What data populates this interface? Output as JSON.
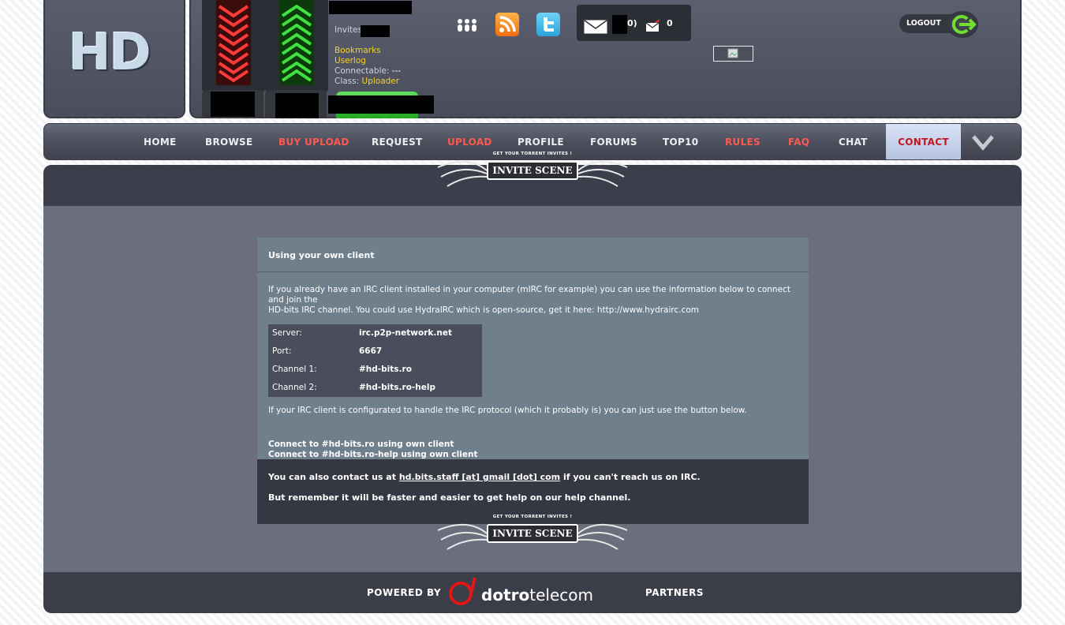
{
  "logo": {
    "text": "HD"
  },
  "user": {
    "invites_label": "Invites",
    "bookmarks": "Bookmarks",
    "userlog": "Userlog",
    "connectable_label": "Connectable:",
    "connectable_value": "---",
    "class_label": "Class:",
    "class_value": "Uploader"
  },
  "messages": {
    "inbox_suffix": "0)",
    "sent_count": "0"
  },
  "logout_label": "LOGOUT",
  "nav": {
    "items": [
      {
        "label": "HOME",
        "style": "normal"
      },
      {
        "label": "BROWSE",
        "style": "normal"
      },
      {
        "label": "BUY UPLOAD",
        "style": "red"
      },
      {
        "label": "REQUEST",
        "style": "normal"
      },
      {
        "label": "UPLOAD",
        "style": "red"
      },
      {
        "label": "PROFILE",
        "style": "normal"
      },
      {
        "label": "FORUMS",
        "style": "normal"
      },
      {
        "label": "TOP10",
        "style": "normal"
      },
      {
        "label": "RULES",
        "style": "red"
      },
      {
        "label": "FAQ",
        "style": "red"
      },
      {
        "label": "CHAT",
        "style": "normal"
      },
      {
        "label": "CONTACT",
        "style": "active"
      }
    ]
  },
  "banner": {
    "tagline": "GET YOUR TORRENT INVITES !",
    "title": "INVITE SCENE"
  },
  "irc": {
    "title": "Using your own client",
    "intro_line1": "If you already have an IRC client installed in your computer (mIRC for example) you can use the information below to connect and join the",
    "intro_line2": "HD-bits IRC channel. You could use HydraIRC which is open-source, get it here: http://www.hydrairc.com",
    "rows": [
      {
        "label": "Server:",
        "value": "irc.p2p-network.net"
      },
      {
        "label": "Port:",
        "value": "6667"
      },
      {
        "label": "Channel 1:",
        "value": "#hd-bits.ro"
      },
      {
        "label": "Channel 2:",
        "value": "#hd-bits.ro-help"
      }
    ],
    "protocol_note": "If your IRC client is configurated to handle the IRC protocol (which it probably is) you can just use the button below.",
    "link1": "Connect to #hd-bits.ro using own client",
    "link2": "Connect to #hd-bits.ro-help using own client",
    "contact_pre": "You can also contact us at",
    "contact_email": "hd.bits.staff [at] gmail [dot] com",
    "contact_post": "if you can't reach us on IRC.",
    "remember": "But remember it will be faster and easier to get help on our help channel."
  },
  "footer": {
    "powered_by": "POWERED BY",
    "brand_bold": "dotro",
    "brand_rest": "telecom",
    "partners": "PARTNERS"
  },
  "colors": {
    "accent_red": "#ff5a50",
    "link_yellow": "#f2d22e",
    "panel": "#6f7f8c"
  }
}
